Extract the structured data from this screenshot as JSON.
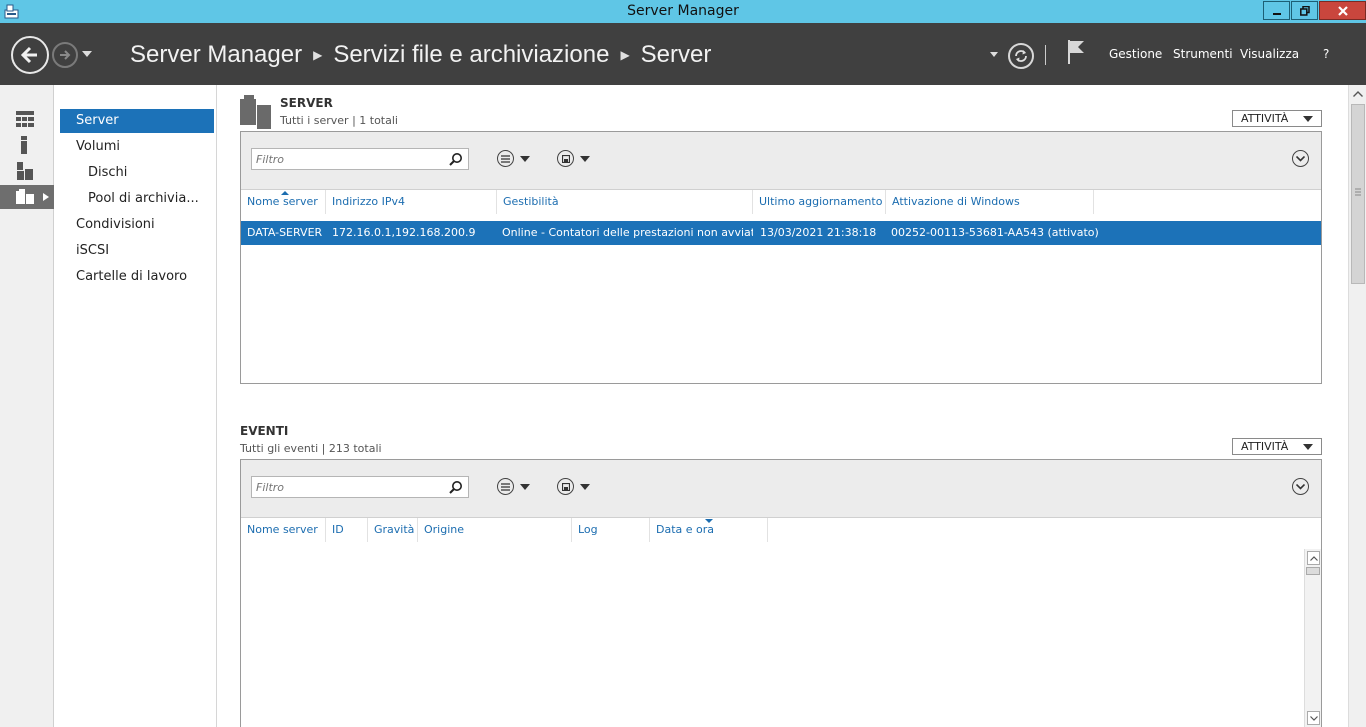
{
  "window": {
    "title": "Server Manager"
  },
  "header": {
    "breadcrumb": [
      "Server Manager",
      "Servizi file e archiviazione",
      "Server"
    ],
    "menus": [
      "Gestione",
      "Strumenti",
      "Visualizza",
      "?"
    ]
  },
  "subnav": {
    "items": [
      {
        "label": "Server",
        "active": true
      },
      {
        "label": "Volumi"
      },
      {
        "label": "Dischi"
      },
      {
        "label": "Pool di archivia..."
      },
      {
        "label": "Condivisioni"
      },
      {
        "label": "iSCSI"
      },
      {
        "label": "Cartelle di lavoro"
      }
    ]
  },
  "servers": {
    "title": "SERVER",
    "subtitle": "Tutti i server | 1 totali",
    "tasks_label": "ATTIVITÀ",
    "filter_placeholder": "Filtro",
    "columns": [
      "Nome server",
      "Indirizzo IPv4",
      "Gestibilità",
      "Ultimo aggiornamento",
      "Attivazione di Windows"
    ],
    "rows": [
      [
        "DATA-SERVER",
        "172.16.0.1,192.168.200.9",
        "Online - Contatori delle prestazioni non avviati",
        "13/03/2021 21:38:18",
        "00252-00113-53681-AA543 (attivato)"
      ]
    ]
  },
  "events": {
    "title": "EVENTI",
    "subtitle": "Tutti gli eventi | 213 totali",
    "tasks_label": "ATTIVITÀ",
    "filter_placeholder": "Filtro",
    "columns": [
      "Nome server",
      "ID",
      "Gravità",
      "Origine",
      "Log",
      "Data e ora"
    ]
  },
  "colors": {
    "titlebar": "#5fc6e6",
    "header": "#404040",
    "selection": "#1c72b8",
    "link": "#1c6db0"
  }
}
